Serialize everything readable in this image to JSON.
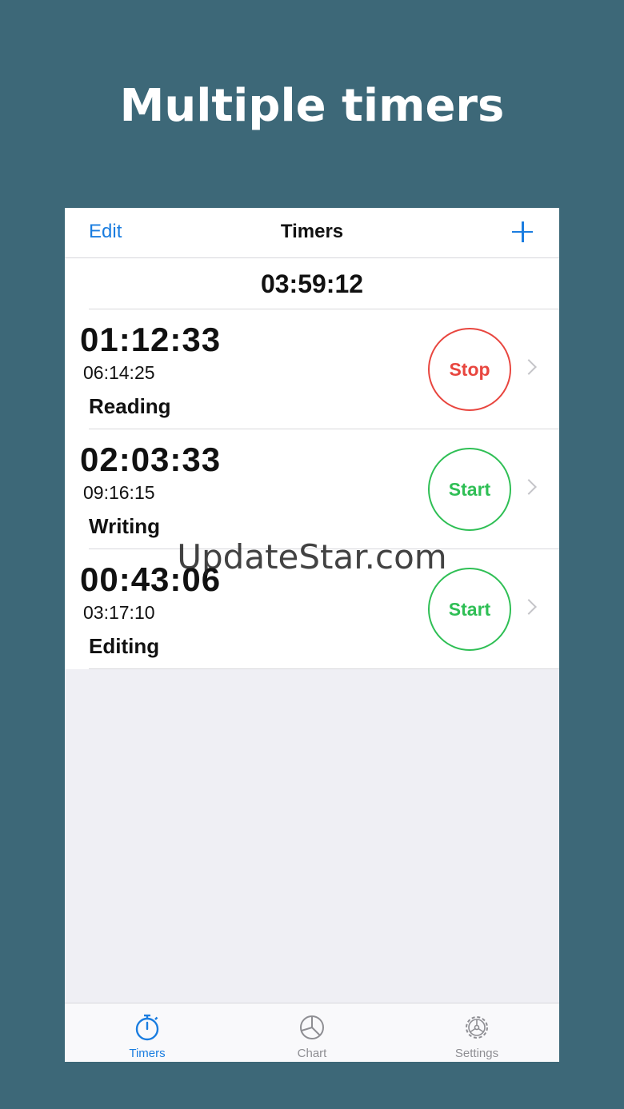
{
  "headline": "Multiple timers",
  "navbar": {
    "edit_label": "Edit",
    "title": "Timers",
    "add_icon": "plus-icon"
  },
  "total_time": "03:59:12",
  "timers": [
    {
      "current": "01:12:33",
      "total": "06:14:25",
      "name": "Reading",
      "button": "Stop",
      "color": "#e8463f"
    },
    {
      "current": "02:03:33",
      "total": "09:16:15",
      "name": "Writing",
      "button": "Start",
      "color": "#2fbf55"
    },
    {
      "current": "00:43:06",
      "total": "03:17:10",
      "name": "Editing",
      "button": "Start",
      "color": "#2fbf55"
    }
  ],
  "tabs": [
    {
      "label": "Timers",
      "icon": "stopwatch-icon",
      "active": true
    },
    {
      "label": "Chart",
      "icon": "pie-chart-icon",
      "active": false
    },
    {
      "label": "Settings",
      "icon": "gear-icon",
      "active": false
    }
  ],
  "colors": {
    "accent": "#1a7de0",
    "background": "#3d6878",
    "inactive": "#8e8e93"
  },
  "watermark": "UpdateStar.com"
}
